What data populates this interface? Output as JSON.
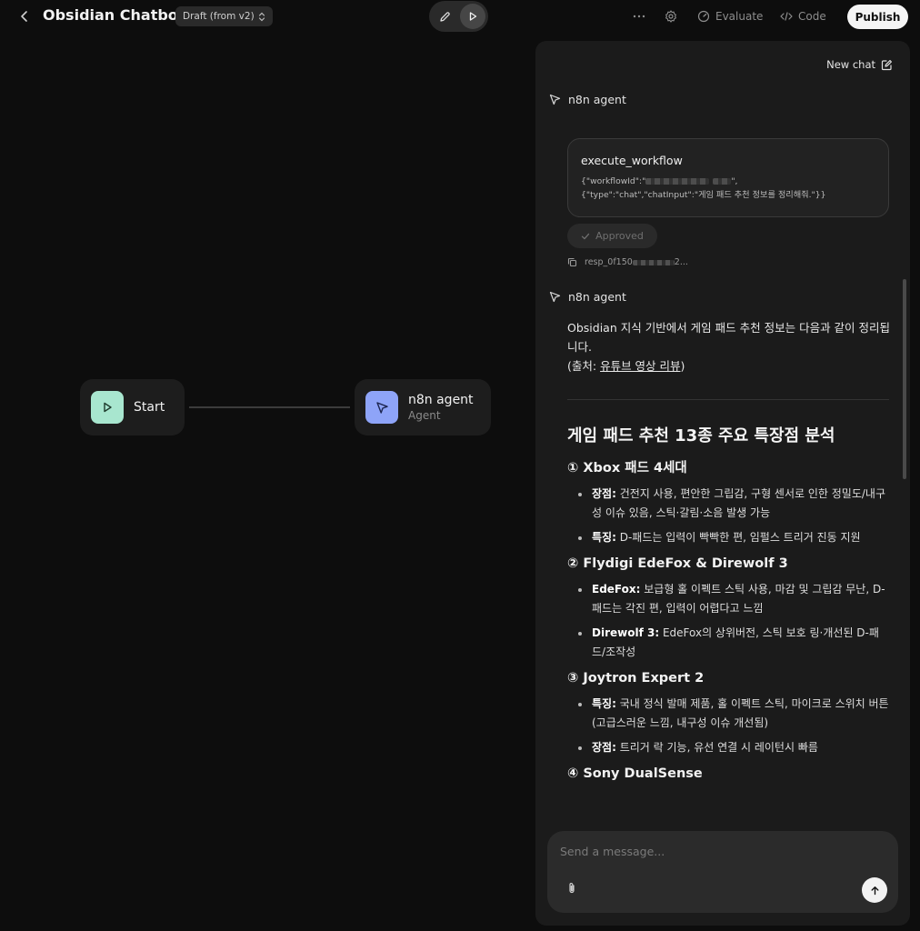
{
  "header": {
    "title": "Obsidian Chatbot",
    "draft_label": "Draft (from v2)",
    "evaluate_label": "Evaluate",
    "code_label": "Code",
    "publish_label": "Publish"
  },
  "canvas": {
    "start_node": {
      "title": "Start"
    },
    "agent_node": {
      "title": "n8n agent",
      "subtitle": "Agent"
    }
  },
  "chat": {
    "new_chat_label": "New chat",
    "agent_name": "n8n agent",
    "tool_call": {
      "name": "execute_workflow",
      "args_line1_prefix": "{\"workflowId\":\"",
      "args_line1_suffix": "\",",
      "args_line2": "{\"type\":\"chat\",\"chatInput\":\"게임 패드 추천 정보를 정리해줘.\"}}",
      "status": "Approved",
      "response_id_prefix": "resp_0f150",
      "response_id_suffix": "2..."
    },
    "answer": {
      "intro": "Obsidian 지식 기반에서 게임 패드 추천 정보는 다음과 같이 정리됩니다.",
      "source_prefix": "(출처: ",
      "source_link": "유튜브 영상 리뷰",
      "source_suffix": ")",
      "heading": "게임 패드 추천 13종 주요 특장점 분석",
      "sections": [
        {
          "title": "① Xbox 패드 4세대",
          "items": [
            {
              "label": "장점:",
              "text": " 건전지 사용, 편안한 그립감, 구형 센서로 인한 정밀도/내구성 이슈 있음, 스틱·갈림·소음 발생 가능"
            },
            {
              "label": "특징:",
              "text": " D-패드는 입력이 빡빡한 편, 임펄스 트리거 진동 지원"
            }
          ]
        },
        {
          "title": "② Flydigi EdeFox & Direwolf 3",
          "items": [
            {
              "label": "EdeFox:",
              "text": " 보급형 홀 이펙트 스틱 사용, 마감 및 그립감 무난, D-패드는 각진 편, 입력이 어렵다고 느낌"
            },
            {
              "label": "Direwolf 3:",
              "text": " EdeFox의 상위버전, 스틱 보호 링·개선된 D-패드/조작성"
            }
          ]
        },
        {
          "title": "③ Joytron Expert 2",
          "items": [
            {
              "label": "특징:",
              "text": " 국내 정식 발매 제품, 홀 이펙트 스틱, 마이크로 스위치 버튼(고급스러운 느낌, 내구성 이슈 개선됨)"
            },
            {
              "label": "장점:",
              "text": " 트리거 락 기능, 유선 연결 시 레이턴시 빠름"
            }
          ]
        },
        {
          "title": "④ Sony DualSense",
          "items": []
        }
      ]
    },
    "composer": {
      "placeholder": "Send a message..."
    }
  },
  "colors": {
    "start_node_icon_bg": "#a8e6cf",
    "agent_node_icon_bg": "#8ea4f8",
    "publish_bg": "#f5f5f5",
    "panel_bg": "#1b1b1b"
  },
  "icons": {
    "back": "chevron-left-icon",
    "draft": "chevron-updown-icon",
    "edit": "pencil-icon",
    "play": "play-icon",
    "more": "ellipsis-icon",
    "settings": "gear-icon",
    "evaluate": "gauge-icon",
    "code": "code-icon",
    "new_chat": "edit-square-icon",
    "agent": "cursor-arrow-icon",
    "approved": "check-icon",
    "copy": "copy-icon",
    "attach": "paperclip-icon",
    "send": "arrow-up-icon"
  }
}
